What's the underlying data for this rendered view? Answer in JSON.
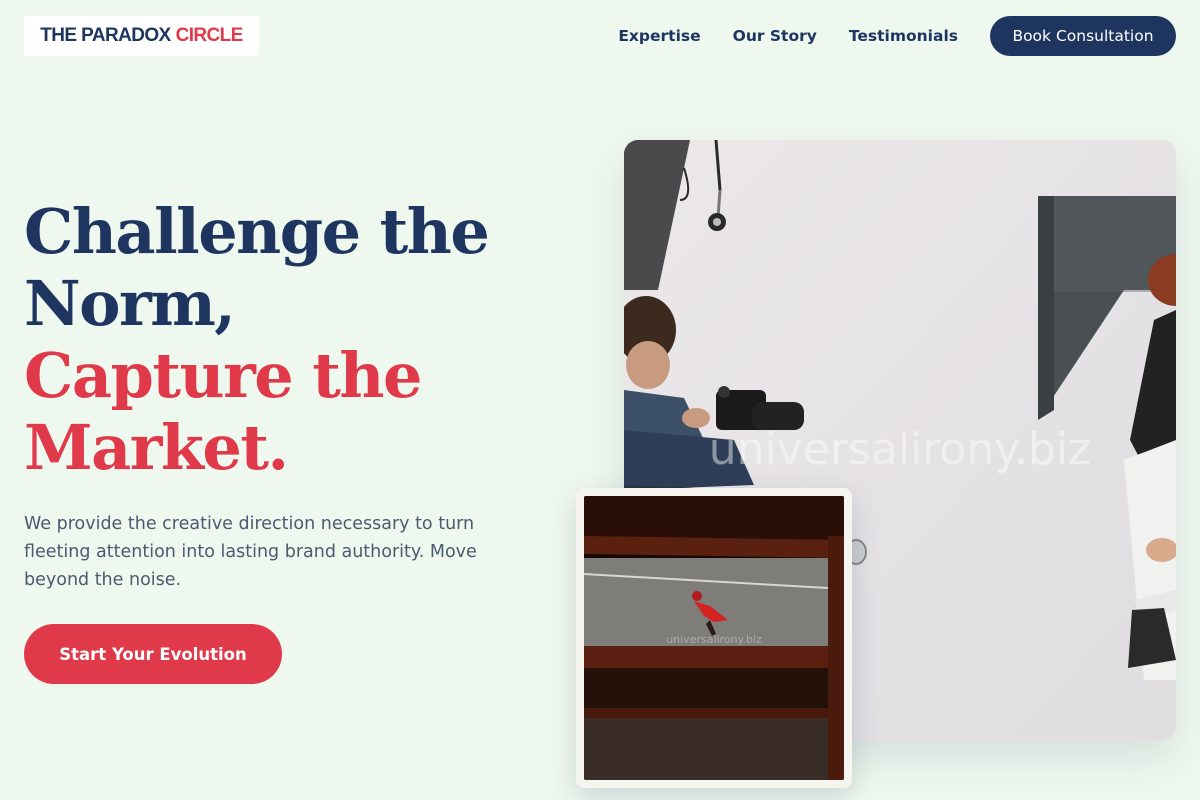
{
  "brand": {
    "name_dark": "THE PARADOX",
    "name_accent": "CIRCLE"
  },
  "nav": {
    "links": [
      "Expertise",
      "Our Story",
      "Testimonials"
    ],
    "cta": "Book Consultation"
  },
  "hero": {
    "headline_line1": "Challenge the",
    "headline_line2": "Norm,",
    "headline_line3": "Capture the",
    "headline_line4": "Market.",
    "lead": "We provide the creative direction necessary to turn fleeting attention into lasting brand authority. Move beyond the noise.",
    "cta": "Start Your Evolution"
  },
  "images": {
    "main_watermark": "universalirony.biz",
    "small_watermark": "universalirony.biz"
  },
  "colors": {
    "navy": "#1e3560",
    "accent_red": "#e03a4a",
    "background": "#eff8ee"
  }
}
